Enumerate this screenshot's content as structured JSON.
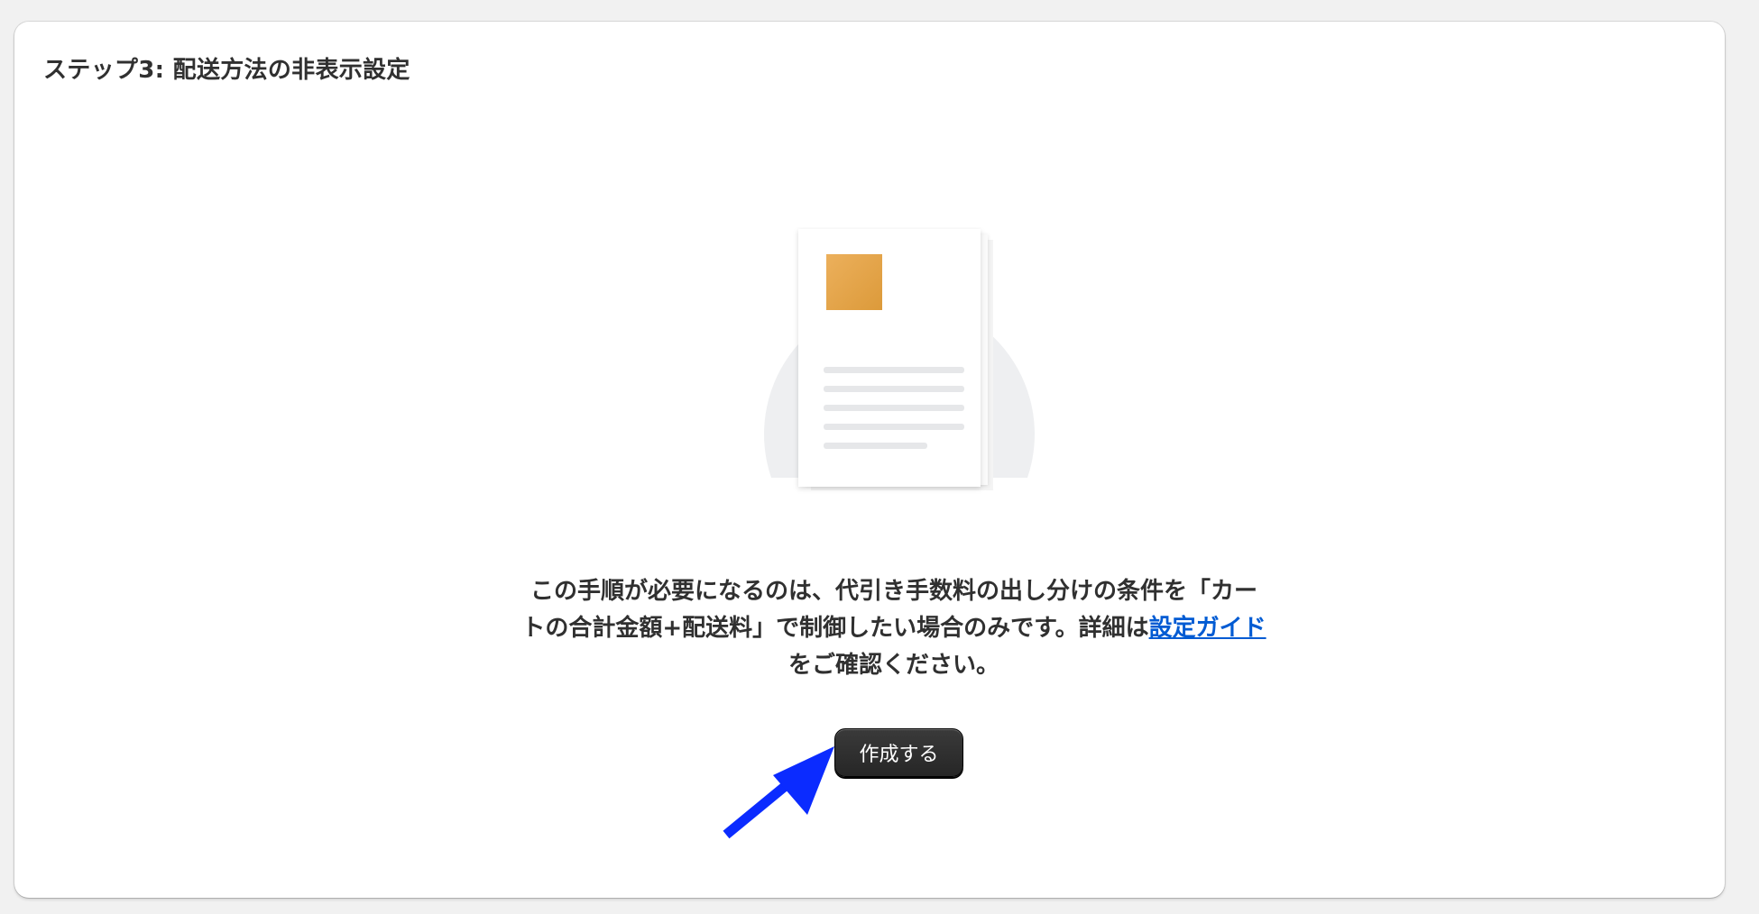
{
  "card": {
    "title": "ステップ3: 配送方法の非表示設定"
  },
  "empty_state": {
    "illustration_icon": "document-icon",
    "description_before_link": "この手順が必要になるのは、代引き手数料の出し分けの条件を「カートの合計金額+配送料」で制御したい場合のみです。詳細は",
    "link_label": "設定ガイド",
    "description_after_link": "をご確認ください。",
    "primary_button_label": "作成する"
  },
  "annotation": {
    "arrow_icon": "arrow-icon",
    "arrow_color": "#0b2bff"
  },
  "colors": {
    "accent_square": "#e6a84f",
    "link": "#005bd3",
    "button_bg": "#303030"
  }
}
